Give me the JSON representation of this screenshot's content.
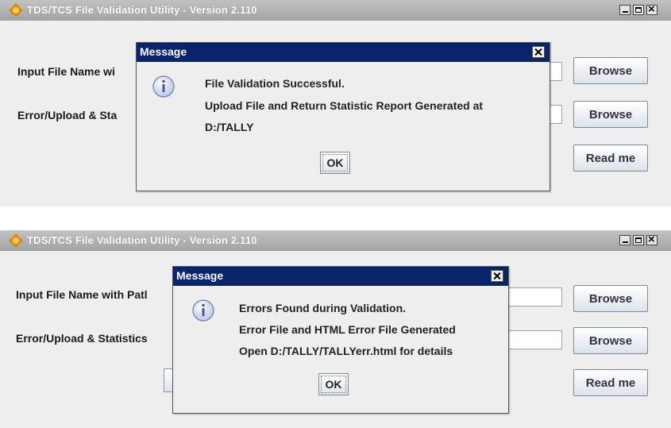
{
  "window_title": "TDS/TCS File Validation Utility - Version 2.110",
  "top": {
    "label_input": "Input File Name wi",
    "label_error": "Error/Upload & Sta",
    "browse_1": "Browse",
    "browse_2": "Browse",
    "readme": "Read me",
    "dialog": {
      "title": "Message",
      "line1": "File Validation Successful.",
      "line2": "Upload File and Return Statistic Report Generated at",
      "line3": "D:/TALLY",
      "ok": "OK"
    }
  },
  "bottom": {
    "label_input": "Input File Name with Patl",
    "label_error": "Error/Upload & Statistics",
    "browse_1": "Browse",
    "browse_2": "Browse",
    "readme": "Read me",
    "dialog": {
      "title": "Message",
      "line1": "Errors Found during Validation.",
      "line2": "Error File and HTML Error File Generated",
      "line3": "Open D:/TALLY/TALLYerr.html for details",
      "ok": "OK"
    }
  }
}
